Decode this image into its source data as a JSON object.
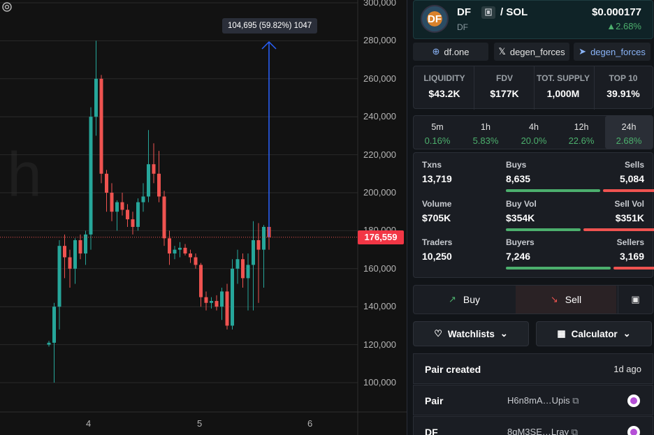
{
  "chart": {
    "y_ticks": [
      "300,000",
      "280,000",
      "260,000",
      "240,000",
      "220,000",
      "200,000",
      "180,000",
      "160,000",
      "140,000",
      "120,000",
      "100,000"
    ],
    "x_ticks": [
      "4",
      "5",
      "6"
    ],
    "current_price_label": "176,559",
    "measure_label": "104,695 (59.82%) 1047",
    "watermark": "h",
    "colors": {
      "up": "#26a69a",
      "down": "#ef5350",
      "measure": "#2962ff"
    }
  },
  "chart_data": {
    "type": "candlestick",
    "title": "",
    "ylim": [
      100000,
      300000
    ],
    "current_price": 176559,
    "x_ticks": [
      "4",
      "5",
      "6"
    ],
    "candles": [
      [
        120000,
        122000,
        119000,
        121000
      ],
      [
        121000,
        142000,
        100000,
        140000
      ],
      [
        140000,
        175000,
        128000,
        172000
      ],
      [
        172000,
        178000,
        155000,
        166000
      ],
      [
        166000,
        170000,
        150000,
        160000
      ],
      [
        160000,
        176000,
        152000,
        175000
      ],
      [
        175000,
        178000,
        165000,
        168000
      ],
      [
        168000,
        180000,
        162000,
        178000
      ],
      [
        178000,
        245000,
        170000,
        240000
      ],
      [
        240000,
        280000,
        230000,
        260000
      ],
      [
        260000,
        262000,
        205000,
        210000
      ],
      [
        210000,
        212000,
        190000,
        200000
      ],
      [
        200000,
        205000,
        185000,
        190000
      ],
      [
        190000,
        196000,
        180000,
        195000
      ],
      [
        195000,
        200000,
        188000,
        191000
      ],
      [
        191000,
        194000,
        182000,
        186000
      ],
      [
        186000,
        190000,
        178000,
        182000
      ],
      [
        182000,
        197000,
        180000,
        195000
      ],
      [
        195000,
        205000,
        190000,
        198000
      ],
      [
        198000,
        233000,
        195000,
        215000
      ],
      [
        215000,
        226000,
        205000,
        210000
      ],
      [
        210000,
        222000,
        195000,
        198000
      ],
      [
        198000,
        201000,
        172000,
        176000
      ],
      [
        176000,
        180000,
        162000,
        168000
      ],
      [
        168000,
        172000,
        165000,
        170000
      ],
      [
        170000,
        174000,
        166000,
        171000
      ],
      [
        171000,
        173000,
        167000,
        168000
      ],
      [
        168000,
        170000,
        163000,
        166000
      ],
      [
        166000,
        168000,
        160000,
        162000
      ],
      [
        162000,
        163000,
        140000,
        145000
      ],
      [
        145000,
        148000,
        138000,
        142000
      ],
      [
        142000,
        145000,
        139000,
        143000
      ],
      [
        143000,
        146000,
        138000,
        140000
      ],
      [
        140000,
        150000,
        133000,
        148000
      ],
      [
        148000,
        152000,
        128000,
        130000
      ],
      [
        130000,
        165000,
        128000,
        160000
      ],
      [
        160000,
        170000,
        152000,
        165000
      ],
      [
        165000,
        168000,
        150000,
        155000
      ],
      [
        155000,
        168000,
        138000,
        162000
      ],
      [
        162000,
        185000,
        138000,
        175000
      ],
      [
        175000,
        184000,
        142000,
        170000
      ],
      [
        170000,
        183000,
        150000,
        182000
      ],
      [
        182000,
        183000,
        170000,
        176559
      ]
    ],
    "candle_fields": [
      "open",
      "high",
      "low",
      "close"
    ],
    "measurement": {
      "label": "104,695 (59.82%) 1047"
    }
  },
  "token": {
    "logo_text": "DF",
    "symbol": "DF",
    "quote": "/ SOL",
    "name": "DF",
    "price": "$0.000177",
    "change": "▲2.68%"
  },
  "links": [
    {
      "icon": "globe-icon",
      "label": "df.one"
    },
    {
      "icon": "x-icon",
      "label": "degen_forces"
    },
    {
      "icon": "telegram-icon",
      "label": "degen_forces"
    }
  ],
  "stats": [
    {
      "label": "LIQUIDITY",
      "value": "$43.2K"
    },
    {
      "label": "FDV",
      "value": "$177K"
    },
    {
      "label": "TOT. SUPPLY",
      "value": "1,000M"
    },
    {
      "label": "TOP 10",
      "value": "39.91%"
    }
  ],
  "timeframes": [
    {
      "label": "5m",
      "value": "0.16%"
    },
    {
      "label": "1h",
      "value": "5.83%"
    },
    {
      "label": "4h",
      "value": "20.0%"
    },
    {
      "label": "12h",
      "value": "22.6%"
    },
    {
      "label": "24h",
      "value": "2.68%"
    }
  ],
  "txns": {
    "txns_label": "Txns",
    "txns_value": "13,719",
    "buys_label": "Buys",
    "buys_value": "8,635",
    "sells_label": "Sells",
    "sells_value": "5,084",
    "volume_label": "Volume",
    "volume_value": "$705K",
    "buyvol_label": "Buy Vol",
    "buyvol_value": "$354K",
    "sellvol_label": "Sell Vol",
    "sellvol_value": "$351K",
    "traders_label": "Traders",
    "traders_value": "10,250",
    "buyers_label": "Buyers",
    "buyers_value": "7,246",
    "sellers_label": "Sellers",
    "sellers_value": "3,169",
    "buy_ratio": 0.63,
    "buyvol_ratio": 0.5,
    "buyers_ratio": 0.7
  },
  "actions": {
    "buy": "Buy",
    "sell": "Sell"
  },
  "dropdowns": {
    "watchlists": "Watchlists",
    "calculator": "Calculator"
  },
  "info": {
    "pair_created_label": "Pair created",
    "pair_created_value": "1d ago",
    "pair_label": "Pair",
    "pair_address": "H6n8mA…Upis",
    "df_label": "DF",
    "df_address": "8qM3SE…Lray"
  }
}
